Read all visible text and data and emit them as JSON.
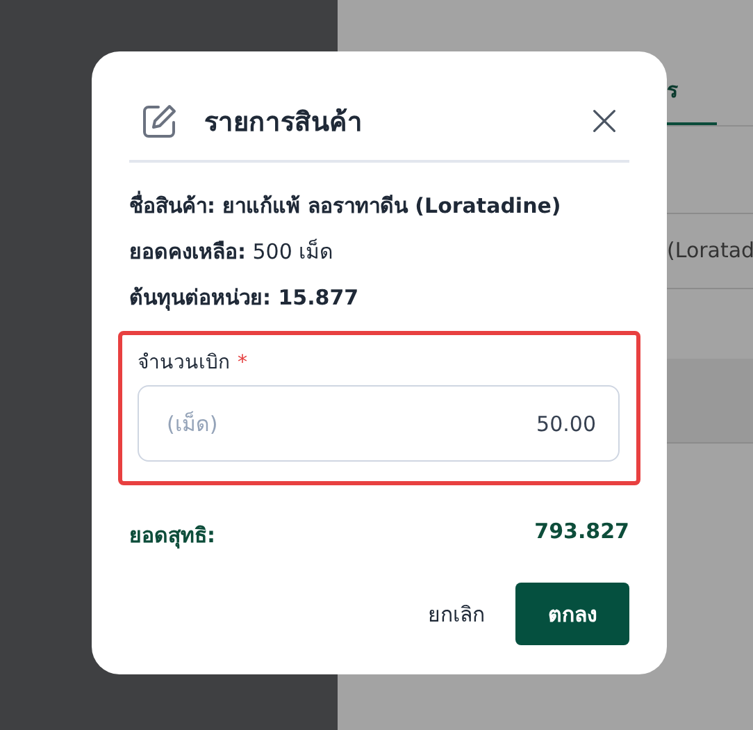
{
  "background": {
    "tab_label": "ร",
    "field_value": "(Loratad"
  },
  "dialog": {
    "title": "รายการสินค้า",
    "details": [
      {
        "label": "ชื่อสินค้า:",
        "value": "ยาแก้แพ้ ลอราทาดีน (Loratadine)",
        "value_bold": true
      },
      {
        "label": "ยอดคงเหลือ:",
        "value": "500 เม็ด",
        "value_bold": false
      },
      {
        "label": "ต้นทุนต่อหน่วย:",
        "value": "15.877",
        "value_bold": true
      }
    ],
    "quantity_field": {
      "label": "จำนวนเบิก",
      "required": true,
      "required_mark": "*",
      "unit": "(เม็ด)",
      "value": "50.00",
      "highlighted": true
    },
    "net_total": {
      "label": "ยอดสุทธิ:",
      "value": "793.827"
    },
    "buttons": [
      {
        "kind": "text",
        "label": "ยกเลิก"
      },
      {
        "kind": "primary",
        "label": "ตกลง"
      }
    ]
  }
}
